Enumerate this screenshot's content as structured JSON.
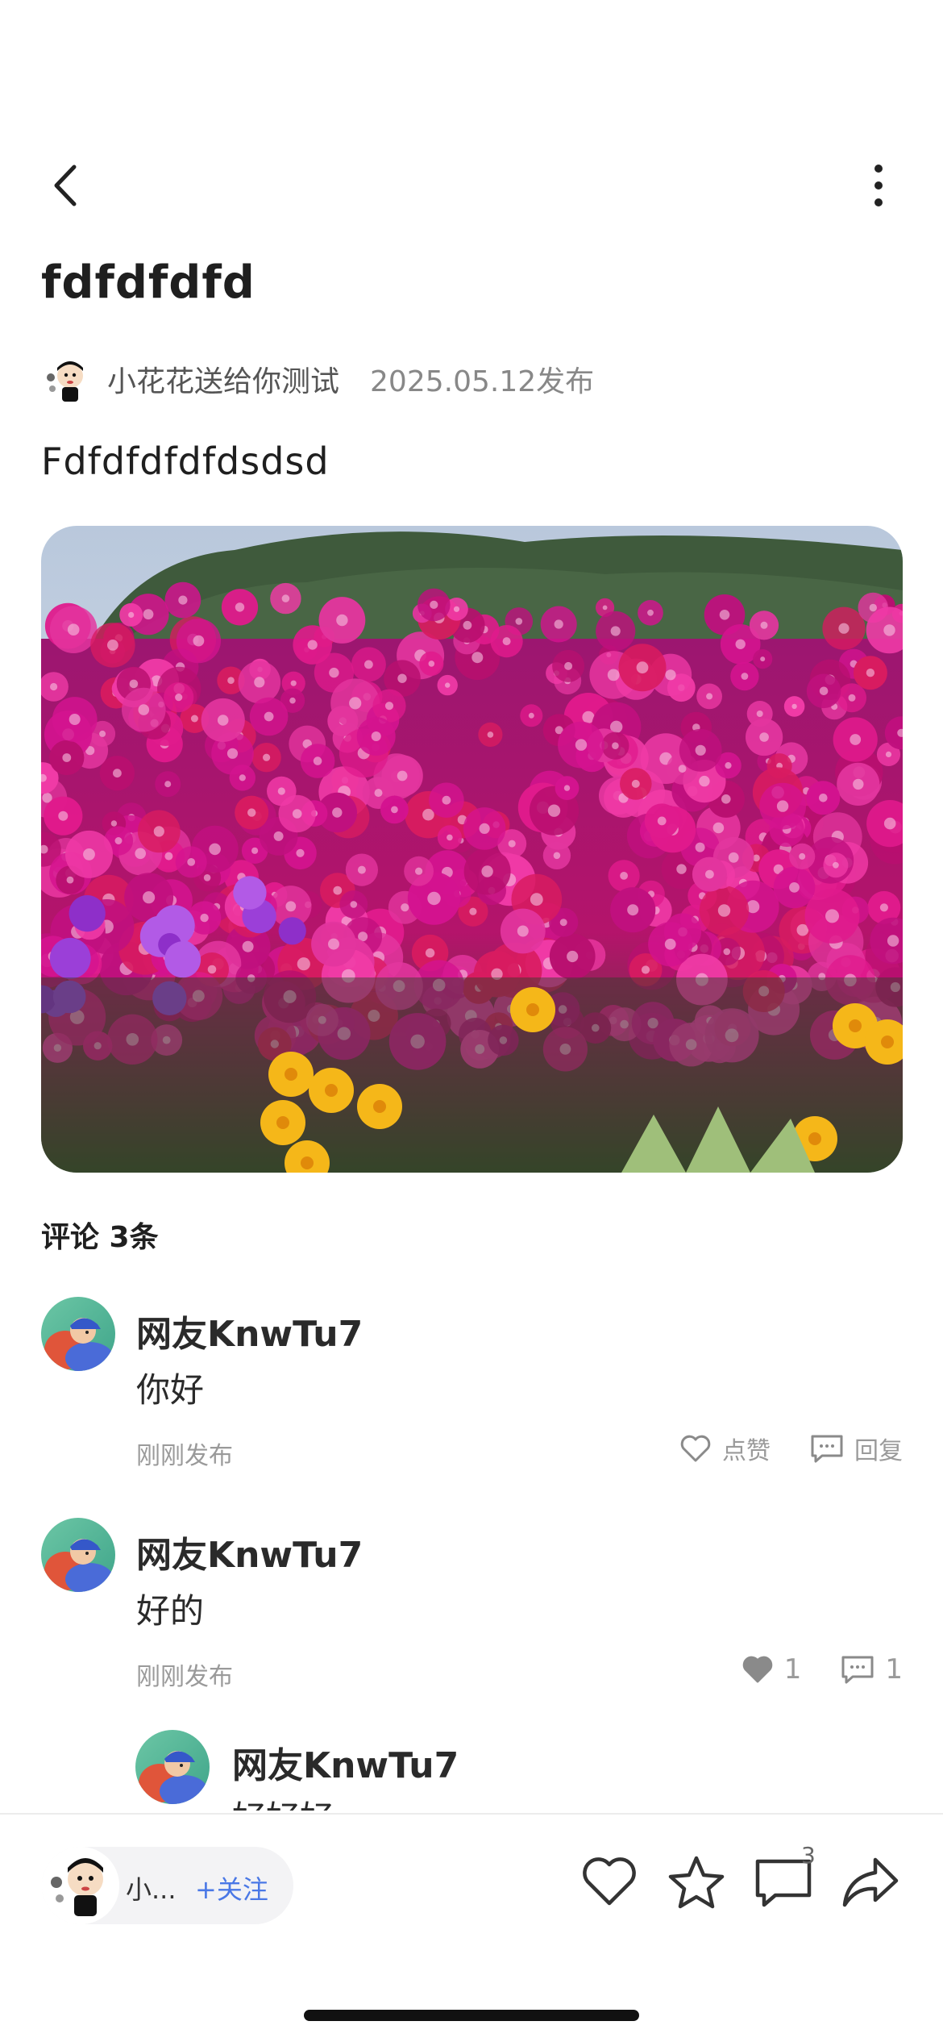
{
  "post": {
    "title": "fdfdfdfd",
    "author_name": "小花花送给你测试",
    "publish_date": "2025.05.12发布",
    "body": "Fdfdfdfdfdsdsd"
  },
  "comments_header": "评论 3条",
  "comments": [
    {
      "name": "网友KnwTu7",
      "text": "你好",
      "time": "刚刚发布",
      "like_label": "点赞",
      "reply_label": "回复"
    },
    {
      "name": "网友KnwTu7",
      "text": "好的",
      "time": "刚刚发布",
      "like_count": "1",
      "reply_count": "1",
      "liked": true
    }
  ],
  "reply": {
    "name": "网友KnwTu7",
    "text": "好好好"
  },
  "bottom_bar": {
    "author_short": "小...",
    "follow_label": "+关注",
    "comment_badge": "3"
  },
  "colors": {
    "accent_blue": "#4a78e6",
    "text_primary": "#1f1f1f",
    "text_secondary": "#9a9a9a"
  },
  "icons": [
    "back-arrow-icon",
    "more-vertical-icon",
    "heart-icon",
    "comment-icon",
    "star-icon",
    "share-icon"
  ]
}
